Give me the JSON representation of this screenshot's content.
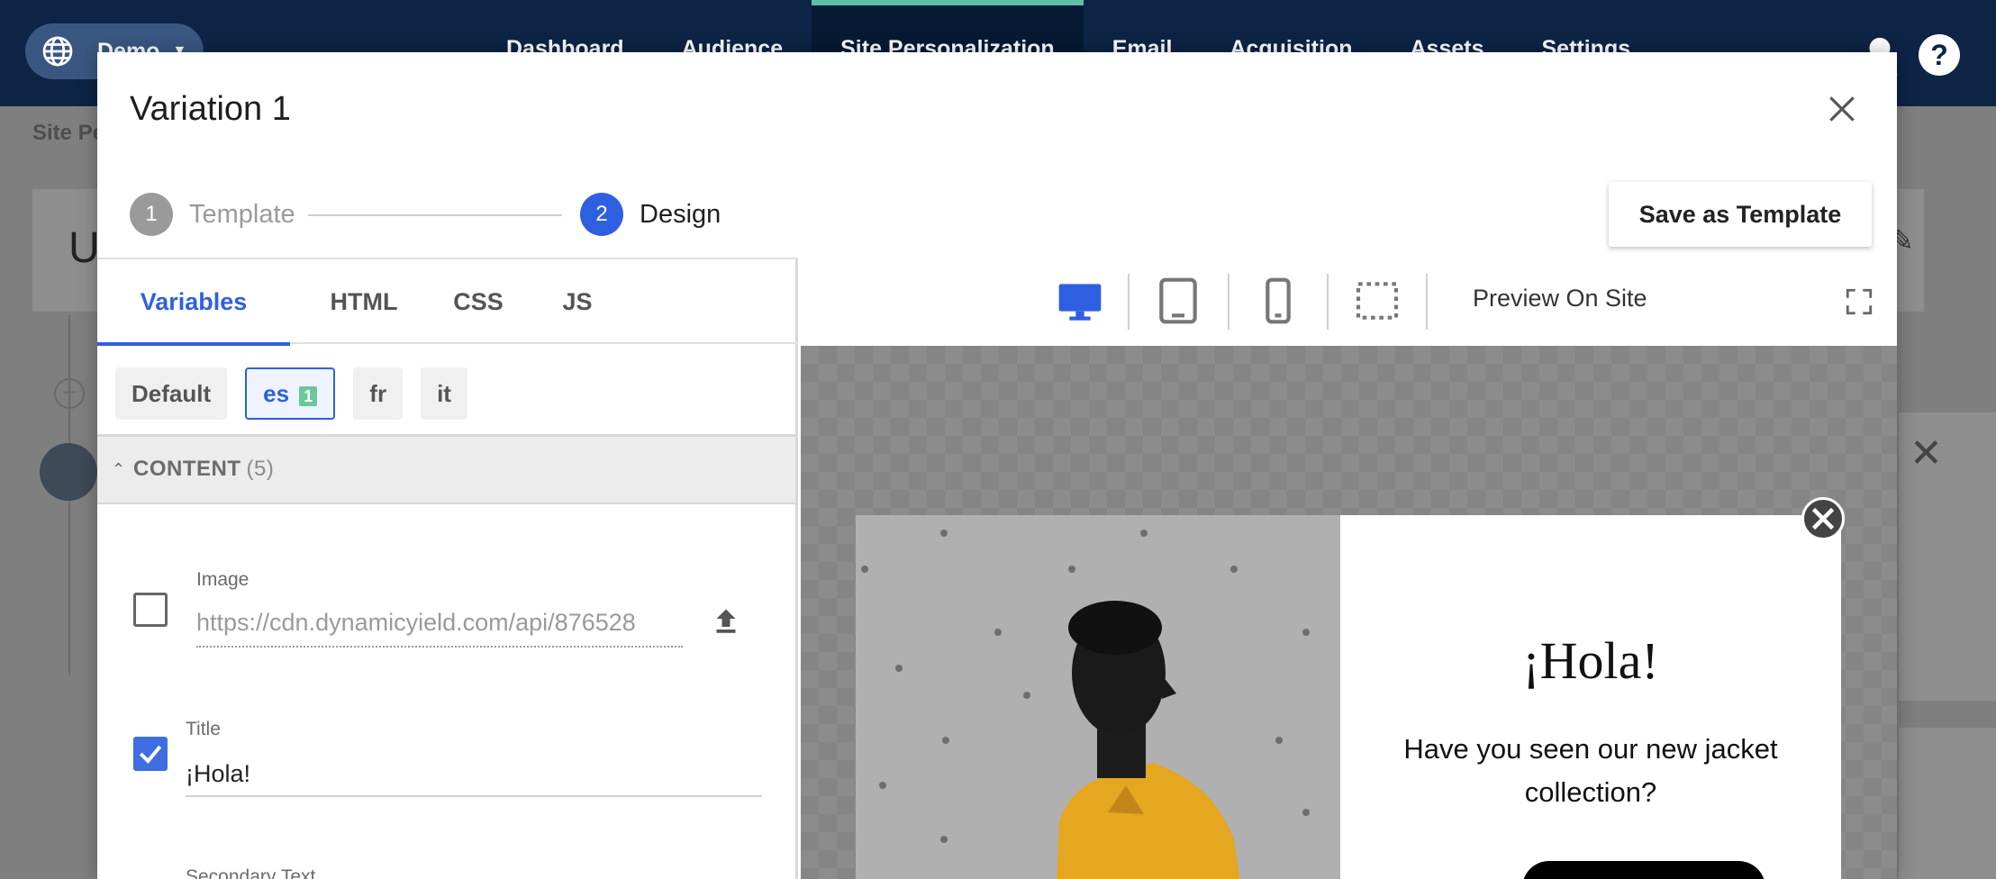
{
  "topnav": {
    "site_name": "Demo",
    "items": [
      "Dashboard",
      "Audience",
      "Site Personalization",
      "Email",
      "Acquisition",
      "Assets",
      "Settings"
    ],
    "active_index": 2
  },
  "background": {
    "breadcrumb": "Site Pe",
    "card_title": "U"
  },
  "modal": {
    "title": "Variation 1",
    "steps": [
      {
        "number": "1",
        "label": "Template"
      },
      {
        "number": "2",
        "label": "Design"
      }
    ],
    "save_template_label": "Save as Template"
  },
  "editor": {
    "tabs": [
      "Variables",
      "HTML",
      "CSS",
      "JS"
    ],
    "languages": [
      {
        "code": "Default"
      },
      {
        "code": "es",
        "badge": "1"
      },
      {
        "code": "fr"
      },
      {
        "code": "it"
      }
    ],
    "content_section": {
      "label": "CONTENT",
      "count": "(5)"
    },
    "fields": {
      "image": {
        "label": "Image",
        "value": "https://cdn.dynamicyield.com/api/876528",
        "checked": false
      },
      "title": {
        "label": "Title",
        "value": "¡Hola!",
        "checked": true
      },
      "secondary": {
        "label": "Secondary Text"
      }
    }
  },
  "preview": {
    "preview_on_site_label": "Preview On Site",
    "popup": {
      "title": "¡Hola!",
      "text": "Have you seen our new jacket collection?"
    }
  },
  "colors": {
    "nav_bg": "#0d2445",
    "accent": "#2f5fe1",
    "badge": "#6cc79a"
  }
}
